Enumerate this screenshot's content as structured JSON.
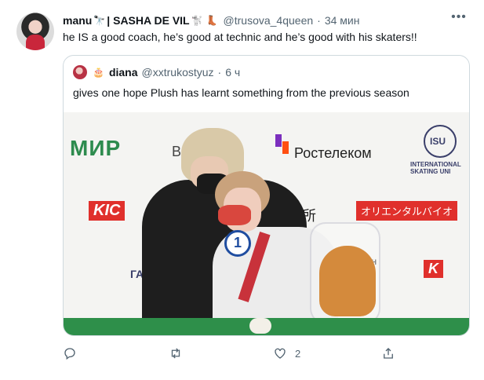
{
  "tweet": {
    "author_name": "manu",
    "author_name_suffix": "| SASHA DE VIL",
    "handle": "@trusova_4queen",
    "dot": "·",
    "time": "34 мин",
    "text": "he IS a good coach, he’s good at technic and he’s good with his skaters!!",
    "more_icon": "more-dots-icon"
  },
  "quote": {
    "author_name": "diana",
    "handle": "@xxtrukostyuz",
    "dot": "·",
    "time": "6 ч",
    "text": "gives one hope Plush has learnt something from the previous season"
  },
  "media": {
    "logos": {
      "mir": "МИР",
      "v": "В",
      "rostelecom": "Ростелеком",
      "isu": "ISU",
      "isu_sub_line1": "INTERNATIONAL",
      "isu_sub_line2": "SKATING UNI",
      "kic": "KIC",
      "japanese": "明和地所",
      "oriental": "オリエンタルバイオ",
      "orion": "ОРИОН",
      "ga": "ГА",
      "kic_right": "K"
    },
    "channel_one": "1"
  },
  "actions": {
    "reply_icon": "reply-icon",
    "retweet_icon": "retweet-icon",
    "like_icon": "like-icon",
    "like_count": "2",
    "share_icon": "share-icon"
  },
  "colors": {
    "text": "#0f1419",
    "secondary": "#536471",
    "border": "#cfd9de",
    "red": "#e0302c",
    "green": "#2d8b4e"
  }
}
